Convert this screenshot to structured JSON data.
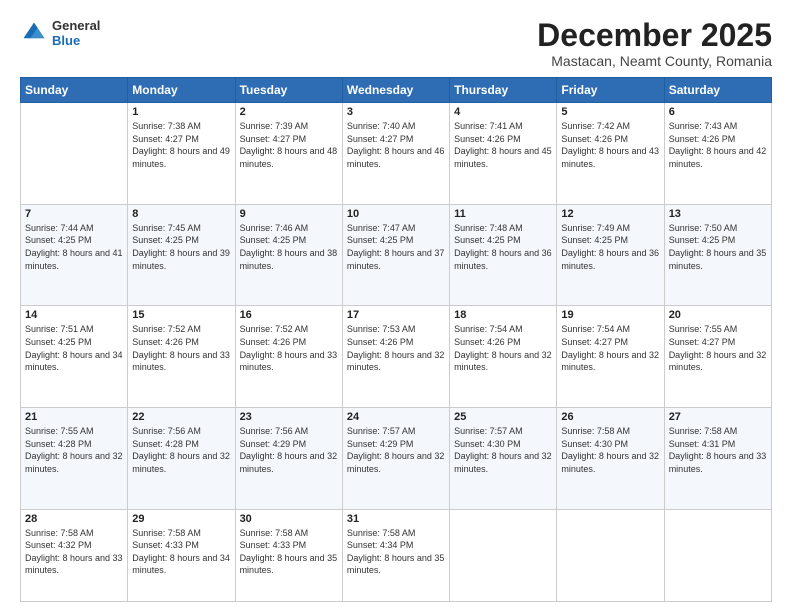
{
  "header": {
    "logo_general": "General",
    "logo_blue": "Blue",
    "month_title": "December 2025",
    "location": "Mastacan, Neamt County, Romania"
  },
  "weekdays": [
    "Sunday",
    "Monday",
    "Tuesday",
    "Wednesday",
    "Thursday",
    "Friday",
    "Saturday"
  ],
  "weeks": [
    [
      {
        "day": "",
        "sunrise": "",
        "sunset": "",
        "daylight": ""
      },
      {
        "day": "1",
        "sunrise": "Sunrise: 7:38 AM",
        "sunset": "Sunset: 4:27 PM",
        "daylight": "Daylight: 8 hours and 49 minutes."
      },
      {
        "day": "2",
        "sunrise": "Sunrise: 7:39 AM",
        "sunset": "Sunset: 4:27 PM",
        "daylight": "Daylight: 8 hours and 48 minutes."
      },
      {
        "day": "3",
        "sunrise": "Sunrise: 7:40 AM",
        "sunset": "Sunset: 4:27 PM",
        "daylight": "Daylight: 8 hours and 46 minutes."
      },
      {
        "day": "4",
        "sunrise": "Sunrise: 7:41 AM",
        "sunset": "Sunset: 4:26 PM",
        "daylight": "Daylight: 8 hours and 45 minutes."
      },
      {
        "day": "5",
        "sunrise": "Sunrise: 7:42 AM",
        "sunset": "Sunset: 4:26 PM",
        "daylight": "Daylight: 8 hours and 43 minutes."
      },
      {
        "day": "6",
        "sunrise": "Sunrise: 7:43 AM",
        "sunset": "Sunset: 4:26 PM",
        "daylight": "Daylight: 8 hours and 42 minutes."
      }
    ],
    [
      {
        "day": "7",
        "sunrise": "Sunrise: 7:44 AM",
        "sunset": "Sunset: 4:25 PM",
        "daylight": "Daylight: 8 hours and 41 minutes."
      },
      {
        "day": "8",
        "sunrise": "Sunrise: 7:45 AM",
        "sunset": "Sunset: 4:25 PM",
        "daylight": "Daylight: 8 hours and 39 minutes."
      },
      {
        "day": "9",
        "sunrise": "Sunrise: 7:46 AM",
        "sunset": "Sunset: 4:25 PM",
        "daylight": "Daylight: 8 hours and 38 minutes."
      },
      {
        "day": "10",
        "sunrise": "Sunrise: 7:47 AM",
        "sunset": "Sunset: 4:25 PM",
        "daylight": "Daylight: 8 hours and 37 minutes."
      },
      {
        "day": "11",
        "sunrise": "Sunrise: 7:48 AM",
        "sunset": "Sunset: 4:25 PM",
        "daylight": "Daylight: 8 hours and 36 minutes."
      },
      {
        "day": "12",
        "sunrise": "Sunrise: 7:49 AM",
        "sunset": "Sunset: 4:25 PM",
        "daylight": "Daylight: 8 hours and 36 minutes."
      },
      {
        "day": "13",
        "sunrise": "Sunrise: 7:50 AM",
        "sunset": "Sunset: 4:25 PM",
        "daylight": "Daylight: 8 hours and 35 minutes."
      }
    ],
    [
      {
        "day": "14",
        "sunrise": "Sunrise: 7:51 AM",
        "sunset": "Sunset: 4:25 PM",
        "daylight": "Daylight: 8 hours and 34 minutes."
      },
      {
        "day": "15",
        "sunrise": "Sunrise: 7:52 AM",
        "sunset": "Sunset: 4:26 PM",
        "daylight": "Daylight: 8 hours and 33 minutes."
      },
      {
        "day": "16",
        "sunrise": "Sunrise: 7:52 AM",
        "sunset": "Sunset: 4:26 PM",
        "daylight": "Daylight: 8 hours and 33 minutes."
      },
      {
        "day": "17",
        "sunrise": "Sunrise: 7:53 AM",
        "sunset": "Sunset: 4:26 PM",
        "daylight": "Daylight: 8 hours and 32 minutes."
      },
      {
        "day": "18",
        "sunrise": "Sunrise: 7:54 AM",
        "sunset": "Sunset: 4:26 PM",
        "daylight": "Daylight: 8 hours and 32 minutes."
      },
      {
        "day": "19",
        "sunrise": "Sunrise: 7:54 AM",
        "sunset": "Sunset: 4:27 PM",
        "daylight": "Daylight: 8 hours and 32 minutes."
      },
      {
        "day": "20",
        "sunrise": "Sunrise: 7:55 AM",
        "sunset": "Sunset: 4:27 PM",
        "daylight": "Daylight: 8 hours and 32 minutes."
      }
    ],
    [
      {
        "day": "21",
        "sunrise": "Sunrise: 7:55 AM",
        "sunset": "Sunset: 4:28 PM",
        "daylight": "Daylight: 8 hours and 32 minutes."
      },
      {
        "day": "22",
        "sunrise": "Sunrise: 7:56 AM",
        "sunset": "Sunset: 4:28 PM",
        "daylight": "Daylight: 8 hours and 32 minutes."
      },
      {
        "day": "23",
        "sunrise": "Sunrise: 7:56 AM",
        "sunset": "Sunset: 4:29 PM",
        "daylight": "Daylight: 8 hours and 32 minutes."
      },
      {
        "day": "24",
        "sunrise": "Sunrise: 7:57 AM",
        "sunset": "Sunset: 4:29 PM",
        "daylight": "Daylight: 8 hours and 32 minutes."
      },
      {
        "day": "25",
        "sunrise": "Sunrise: 7:57 AM",
        "sunset": "Sunset: 4:30 PM",
        "daylight": "Daylight: 8 hours and 32 minutes."
      },
      {
        "day": "26",
        "sunrise": "Sunrise: 7:58 AM",
        "sunset": "Sunset: 4:30 PM",
        "daylight": "Daylight: 8 hours and 32 minutes."
      },
      {
        "day": "27",
        "sunrise": "Sunrise: 7:58 AM",
        "sunset": "Sunset: 4:31 PM",
        "daylight": "Daylight: 8 hours and 33 minutes."
      }
    ],
    [
      {
        "day": "28",
        "sunrise": "Sunrise: 7:58 AM",
        "sunset": "Sunset: 4:32 PM",
        "daylight": "Daylight: 8 hours and 33 minutes."
      },
      {
        "day": "29",
        "sunrise": "Sunrise: 7:58 AM",
        "sunset": "Sunset: 4:33 PM",
        "daylight": "Daylight: 8 hours and 34 minutes."
      },
      {
        "day": "30",
        "sunrise": "Sunrise: 7:58 AM",
        "sunset": "Sunset: 4:33 PM",
        "daylight": "Daylight: 8 hours and 35 minutes."
      },
      {
        "day": "31",
        "sunrise": "Sunrise: 7:58 AM",
        "sunset": "Sunset: 4:34 PM",
        "daylight": "Daylight: 8 hours and 35 minutes."
      },
      {
        "day": "",
        "sunrise": "",
        "sunset": "",
        "daylight": ""
      },
      {
        "day": "",
        "sunrise": "",
        "sunset": "",
        "daylight": ""
      },
      {
        "day": "",
        "sunrise": "",
        "sunset": "",
        "daylight": ""
      }
    ]
  ]
}
